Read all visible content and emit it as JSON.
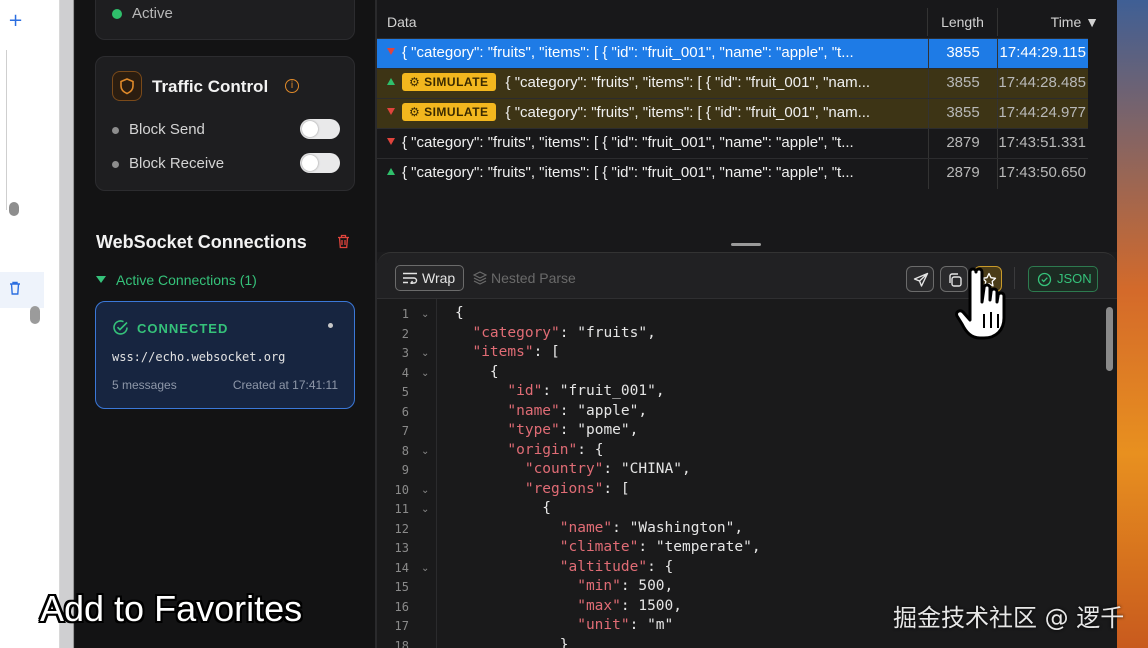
{
  "left_strip": {
    "plus_icon": "plus-icon",
    "trash_icon": "trash-icon"
  },
  "traffic_status": {
    "label": "Active",
    "dot_color": "#2fbf6b"
  },
  "traffic_control": {
    "title": "Traffic Control",
    "rows": [
      {
        "label": "Block Send",
        "enabled": false
      },
      {
        "label": "Block Receive",
        "enabled": false
      }
    ]
  },
  "websocket": {
    "title": "WebSocket Connections",
    "active_label": "Active Connections (1)",
    "connection": {
      "status": "CONNECTED",
      "url": "wss://echo.websocket.org",
      "messages": "5 messages",
      "created": "Created at 17:41:11"
    }
  },
  "table": {
    "headers": {
      "data": "Data",
      "length": "Length",
      "time": "Time ▼"
    },
    "rows": [
      {
        "direction": "down",
        "simulate": false,
        "selected": true,
        "data": "{ \"category\": \"fruits\", \"items\": [ { \"id\": \"fruit_001\", \"name\": \"apple\", \"t...",
        "length": "3855",
        "time": "17:44:29.115"
      },
      {
        "direction": "up",
        "simulate": true,
        "selected": false,
        "data": "{ \"category\": \"fruits\", \"items\": [ { \"id\": \"fruit_001\", \"nam...",
        "length": "3855",
        "time": "17:44:28.485"
      },
      {
        "direction": "down",
        "simulate": true,
        "selected": false,
        "data": "{ \"category\": \"fruits\", \"items\": [ { \"id\": \"fruit_001\", \"nam...",
        "length": "3855",
        "time": "17:44:24.977"
      },
      {
        "direction": "down",
        "simulate": false,
        "selected": false,
        "data": "{ \"category\": \"fruits\", \"items\": [ { \"id\": \"fruit_001\", \"name\": \"apple\", \"t...",
        "length": "2879",
        "time": "17:43:51.331"
      },
      {
        "direction": "up",
        "simulate": false,
        "selected": false,
        "data": "{ \"category\": \"fruits\", \"items\": [ { \"id\": \"fruit_001\", \"name\": \"apple\", \"t...",
        "length": "2879",
        "time": "17:43:50.650"
      }
    ],
    "simulate_label": "SIMULATE"
  },
  "toolbar": {
    "wrap_label": "Wrap",
    "nested_parse_label": "Nested Parse",
    "json_label": "JSON",
    "send_icon": "send-icon",
    "copy_icon": "copy-icon",
    "favorite_icon": "star-icon"
  },
  "code": {
    "lines": [
      {
        "n": "1",
        "fold": true,
        "text": "{"
      },
      {
        "n": "2",
        "fold": false,
        "text": "  \"category\": \"fruits\","
      },
      {
        "n": "3",
        "fold": true,
        "text": "  \"items\": ["
      },
      {
        "n": "4",
        "fold": true,
        "text": "    {"
      },
      {
        "n": "5",
        "fold": false,
        "text": "      \"id\": \"fruit_001\","
      },
      {
        "n": "6",
        "fold": false,
        "text": "      \"name\": \"apple\","
      },
      {
        "n": "7",
        "fold": false,
        "text": "      \"type\": \"pome\","
      },
      {
        "n": "8",
        "fold": true,
        "text": "      \"origin\": {"
      },
      {
        "n": "9",
        "fold": false,
        "text": "        \"country\": \"CHINA\","
      },
      {
        "n": "10",
        "fold": true,
        "text": "        \"regions\": ["
      },
      {
        "n": "11",
        "fold": true,
        "text": "          {"
      },
      {
        "n": "12",
        "fold": false,
        "text": "            \"name\": \"Washington\","
      },
      {
        "n": "13",
        "fold": false,
        "text": "            \"climate\": \"temperate\","
      },
      {
        "n": "14",
        "fold": true,
        "text": "            \"altitude\": {"
      },
      {
        "n": "15",
        "fold": false,
        "text": "              \"min\": 500,"
      },
      {
        "n": "16",
        "fold": false,
        "text": "              \"max\": 1500,"
      },
      {
        "n": "17",
        "fold": false,
        "text": "              \"unit\": \"m\""
      },
      {
        "n": "18",
        "fold": false,
        "text": "            }"
      }
    ]
  },
  "caption": "Add to Favorites",
  "watermark": "掘金技术社区 @ 逻千",
  "colors": {
    "accent_green": "#35c27a",
    "selected_blue": "#1e7be6",
    "simulate_yellow": "#f3b71e",
    "down_red": "#e0443c"
  }
}
